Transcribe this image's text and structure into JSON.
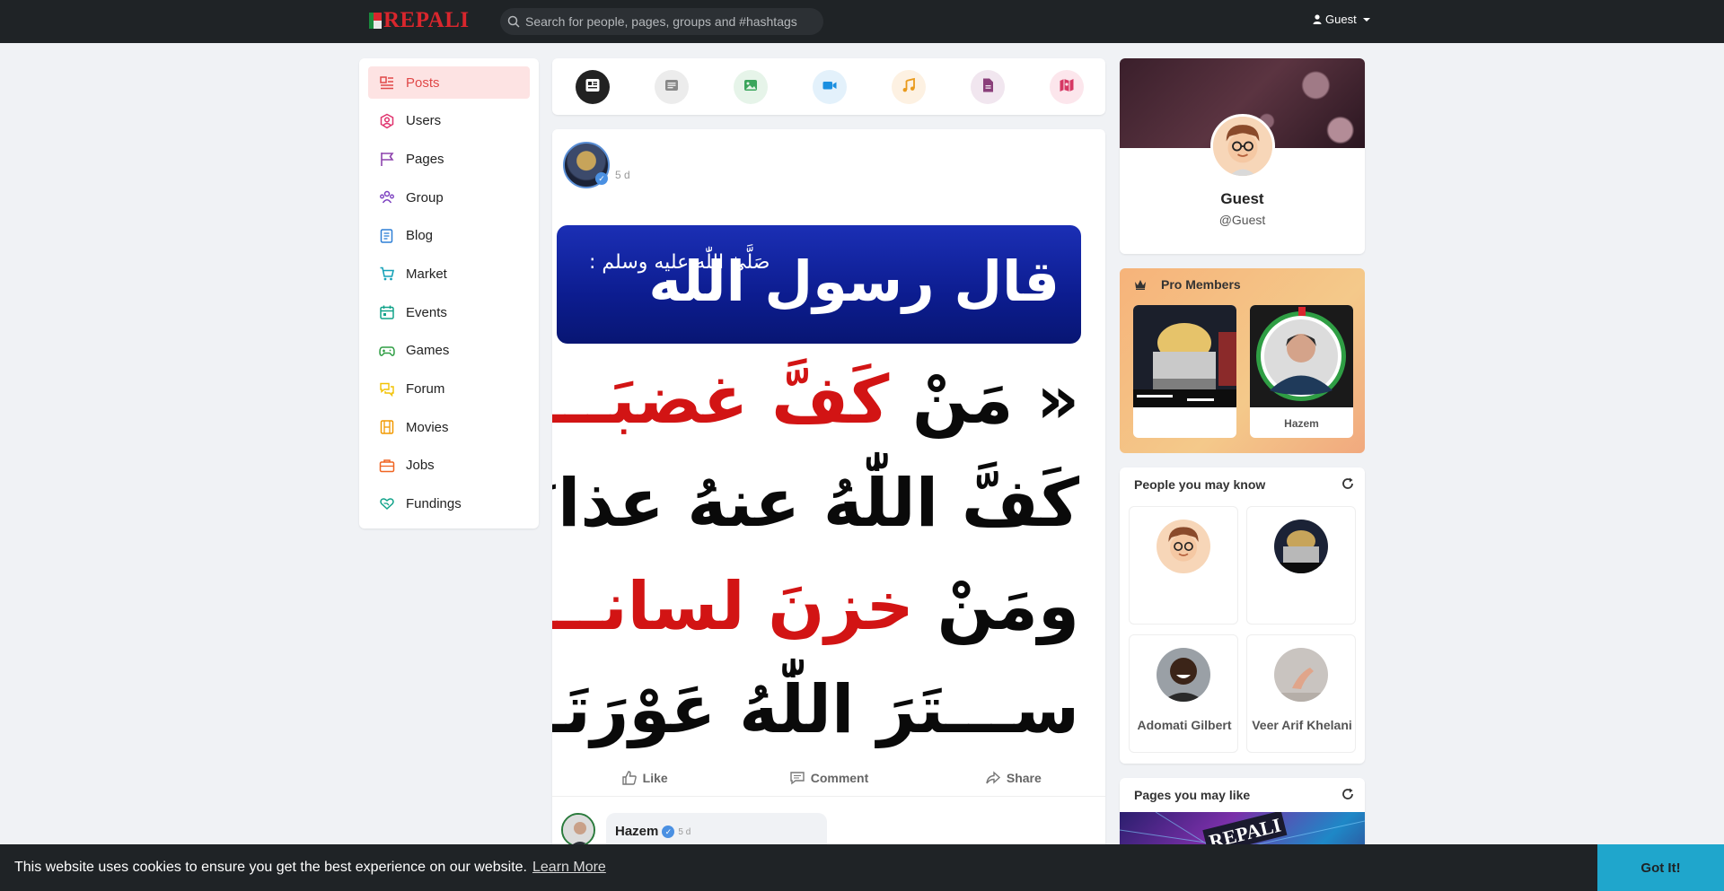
{
  "brand": {
    "logo_text": "REPALI"
  },
  "search": {
    "placeholder": "Search for people, pages, groups and #hashtags"
  },
  "user_menu": {
    "label": "Guest"
  },
  "sidebar": {
    "items": [
      {
        "label": "Posts",
        "icon": "posts-icon",
        "color": "#e04848",
        "active": true
      },
      {
        "label": "Users",
        "icon": "users-icon",
        "color": "#e0356f"
      },
      {
        "label": "Pages",
        "icon": "flag-icon",
        "color": "#8e44ad"
      },
      {
        "label": "Group",
        "icon": "group-icon",
        "color": "#7b3fbf"
      },
      {
        "label": "Blog",
        "icon": "blog-icon",
        "color": "#2d7fd6"
      },
      {
        "label": "Market",
        "icon": "cart-icon",
        "color": "#17a2b8"
      },
      {
        "label": "Events",
        "icon": "calendar-icon",
        "color": "#12a38a"
      },
      {
        "label": "Games",
        "icon": "gamepad-icon",
        "color": "#2f9e44"
      },
      {
        "label": "Forum",
        "icon": "forum-icon",
        "color": "#f2c200"
      },
      {
        "label": "Movies",
        "icon": "film-icon",
        "color": "#f29900"
      },
      {
        "label": "Jobs",
        "icon": "briefcase-icon",
        "color": "#f06522"
      },
      {
        "label": "Fundings",
        "icon": "heart-hand-icon",
        "color": "#12a38a"
      }
    ]
  },
  "post_types": [
    {
      "name": "news-feed-icon",
      "bg": "#222",
      "fg": "#fff"
    },
    {
      "name": "text-post-icon",
      "bg": "#ececec",
      "fg": "#888"
    },
    {
      "name": "image-post-icon",
      "bg": "#e6f4e9",
      "fg": "#3ba55c"
    },
    {
      "name": "video-post-icon",
      "bg": "#e3f1fb",
      "fg": "#1b8fe0"
    },
    {
      "name": "audio-post-icon",
      "bg": "#fdf1e2",
      "fg": "#e99a1b"
    },
    {
      "name": "file-post-icon",
      "bg": "#f1e6ef",
      "fg": "#8a3f7a"
    },
    {
      "name": "map-post-icon",
      "bg": "#fce6ec",
      "fg": "#d63864"
    }
  ],
  "post": {
    "author": "﻿﻿﻿﻿ ﻿﻿",
    "time": "5 d",
    "image": {
      "banner_main": "قال رسول الله",
      "banner_small": "صَلَّىٰ اللّٰه عليه وسلم :",
      "line1_black": "« مَنْ",
      "line1_red": "كَفَّ غضبَـــهُ",
      "line2": "كَفَّ اللّٰهُ عنهُ عذابَهُ،",
      "line3_black": "ومَنْ",
      "line3_red": "خزنَ لسانــــهُ",
      "line4": "ســـتَرَ اللّٰهُ عَوْرَتَــــهُ،"
    },
    "actions": {
      "like": "Like",
      "comment": "Comment",
      "share": "Share"
    },
    "comment": {
      "author": "Hazem",
      "time": "5 d"
    }
  },
  "profile": {
    "name": "Guest",
    "handle": "@Guest"
  },
  "pro_members": {
    "title": "Pro Members",
    "members": [
      {
        "name": "﻿﻿﻿﻿ ﻿﻿"
      },
      {
        "name": "Hazem"
      }
    ]
  },
  "people": {
    "title": "People you may know",
    "items": [
      {
        "name": "﻿﻿﻿ ﻿﻿﻿﻿"
      },
      {
        "name": "﻿﻿﻿﻿ ﻿﻿"
      },
      {
        "name": "Adomati Gilbert"
      },
      {
        "name": "Veer Arif Khelani"
      }
    ]
  },
  "pages": {
    "title": "Pages you may like"
  },
  "cookie": {
    "message": "This website uses cookies to ensure you get the best experience on our website.",
    "link": "Learn More",
    "button": "Got It!"
  },
  "colors": {
    "accent": "#d9262d",
    "topbar": "#1f2326",
    "cookie_button": "#1fa6cc",
    "verified": "#4a90e2"
  }
}
